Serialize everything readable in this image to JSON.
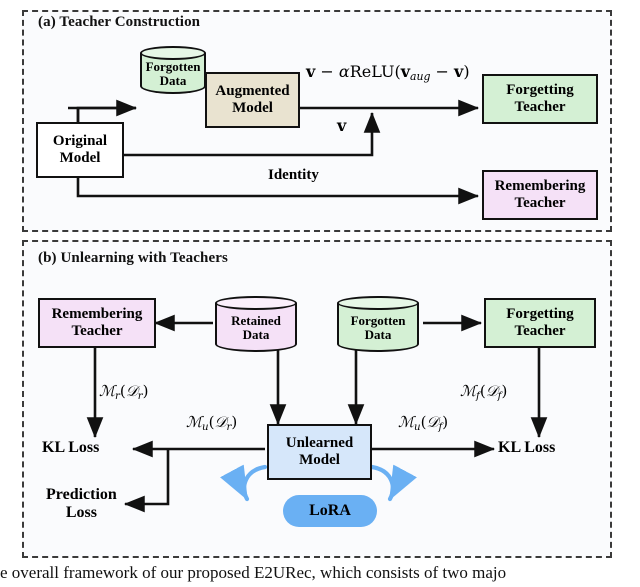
{
  "panel_a": {
    "title": "(a) Teacher Construction",
    "nodes": {
      "original_model": "Original\nModel",
      "original_model_line1": "Original",
      "original_model_line2": "Model",
      "forgotten_data_line1": "Forgotten",
      "forgotten_data_line2": "Data",
      "augmented_model_line1": "Augmented",
      "augmented_model_line2": "Model",
      "forgetting_teacher_line1": "Forgetting",
      "forgetting_teacher_line2": "Teacher",
      "remembering_teacher_line1": "Remembering",
      "remembering_teacher_line2": "Teacher"
    },
    "edge_labels": {
      "formula": "v − αReLU(v_aug − v)",
      "v": "v",
      "identity": "Identity"
    }
  },
  "panel_b": {
    "title": "(b) Unlearning with Teachers",
    "nodes": {
      "remembering_teacher_line1": "Remembering",
      "remembering_teacher_line2": "Teacher",
      "retained_data_line1": "Retained",
      "retained_data_line2": "Data",
      "forgotten_data_line1": "Forgotten",
      "forgotten_data_line2": "Data",
      "forgetting_teacher_line1": "Forgetting",
      "forgetting_teacher_line2": "Teacher",
      "unlearned_model_line1": "Unlearned",
      "unlearned_model_line2": "Model",
      "lora": "LoRA",
      "kl_loss_left": "KL Loss",
      "kl_loss_right": "KL Loss",
      "prediction_loss_line1": "Prediction",
      "prediction_loss_line2": "Loss"
    },
    "edge_labels": {
      "m_r_dr": "M_r(D_r)",
      "m_u_dr": "M_u(D_r)",
      "m_f_df": "M_f(D_f)",
      "m_u_df": "M_u(D_f)"
    }
  },
  "caption": "e overall framework of our proposed E2URec, which consists of two majo",
  "colors": {
    "green": "#d4f0d4",
    "pink": "#f5e1f7",
    "beige": "#e9e3d0",
    "blue_fill": "#d6e7fa",
    "lora_blue": "#6ab0f3",
    "panel_bg": "#fafbfd",
    "stroke": "#111111"
  }
}
